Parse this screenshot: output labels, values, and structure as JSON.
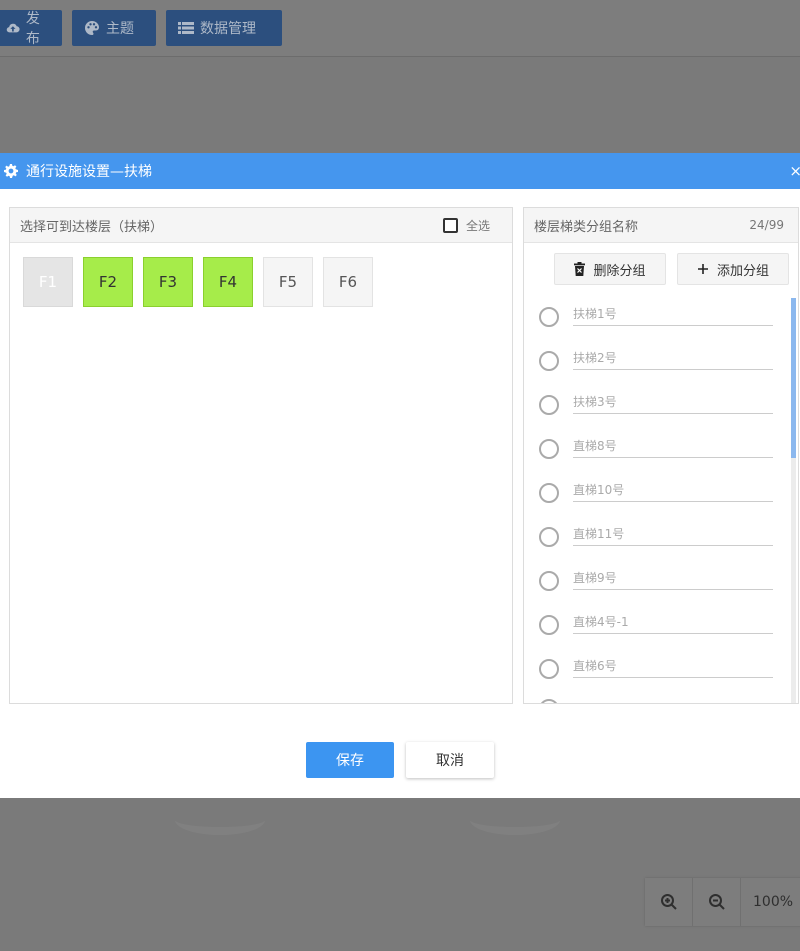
{
  "toolbar": {
    "publish_label": "发布",
    "theme_label": "主题",
    "data_manage_label": "数据管理"
  },
  "modal": {
    "title": "通行设施设置—扶梯",
    "close_symbol": "×",
    "left_panel": {
      "title": "选择可到达楼层（扶梯）",
      "select_all_label": "全选",
      "select_all_checked": false,
      "floors": [
        {
          "label": "F1",
          "state": "disabled"
        },
        {
          "label": "F2",
          "state": "selected"
        },
        {
          "label": "F3",
          "state": "selected"
        },
        {
          "label": "F4",
          "state": "selected"
        },
        {
          "label": "F5",
          "state": "normal"
        },
        {
          "label": "F6",
          "state": "normal"
        }
      ]
    },
    "right_panel": {
      "title": "楼层梯类分组名称",
      "count": "24/99",
      "delete_group_label": "删除分组",
      "add_group_label": "添加分组",
      "groups": [
        {
          "name": "扶梯1号"
        },
        {
          "name": "扶梯2号"
        },
        {
          "name": "扶梯3号"
        },
        {
          "name": "直梯8号"
        },
        {
          "name": "直梯10号"
        },
        {
          "name": "直梯11号"
        },
        {
          "name": "直梯9号"
        },
        {
          "name": "直梯4号-1"
        },
        {
          "name": "直梯6号"
        }
      ]
    },
    "save_label": "保存",
    "cancel_label": "取消"
  },
  "zoom": {
    "percent": "100%"
  },
  "colors": {
    "header_blue": "#4596ee",
    "selected_green": "#a6ec4a",
    "primary_button": "#3c95f1"
  }
}
